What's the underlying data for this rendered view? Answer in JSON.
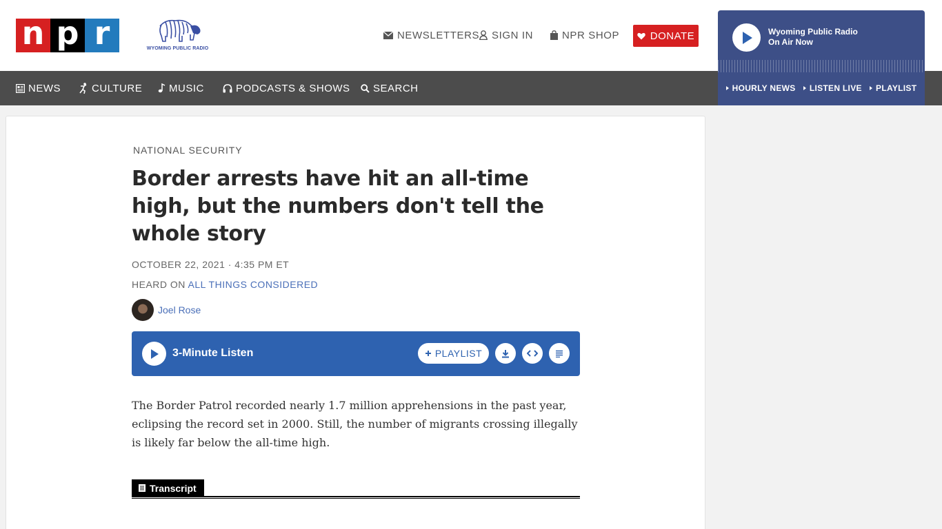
{
  "header": {
    "logo_letters": [
      "n",
      "p",
      "r"
    ],
    "station_logo_text": "WYOMING PUBLIC RADIO",
    "newsletters": "NEWSLETTERS",
    "sign_in": "SIGN IN",
    "shop": "NPR SHOP",
    "donate": "DONATE"
  },
  "nav": {
    "items": [
      {
        "label": "NEWS",
        "icon": "news-icon"
      },
      {
        "label": "CULTURE",
        "icon": "culture-icon"
      },
      {
        "label": "MUSIC",
        "icon": "music-icon"
      },
      {
        "label": "PODCASTS & SHOWS",
        "icon": "headphones-icon"
      },
      {
        "label": "SEARCH",
        "icon": "search-icon"
      }
    ]
  },
  "player": {
    "station": "Wyoming Public Radio",
    "status": "On Air Now",
    "links": [
      "HOURLY NEWS",
      "LISTEN LIVE",
      "PLAYLIST"
    ]
  },
  "article": {
    "slug": "NATIONAL SECURITY",
    "headline": "Border arrests have hit an all-time high, but the numbers don't tell the whole story",
    "date": "OCTOBER 22, 2021 · 4:35 PM ET",
    "heard_on_prefix": "HEARD ON ",
    "heard_on_show": "ALL THINGS CONSIDERED",
    "author": "Joel Rose",
    "audio_title": "3-Minute Listen",
    "playlist_label": "PLAYLIST",
    "teaser": "The Border Patrol recorded nearly 1.7 million apprehensions in the past year, eclipsing the record set in 2000. Still, the number of migrants crossing illegally is likely far below the all-time high.",
    "transcript_label": "Transcript"
  },
  "colors": {
    "npr_red": "#d62021",
    "npr_black": "#000000",
    "npr_blue": "#237bbd",
    "nav_bg": "#4c4c4c",
    "player_bg": "#3d4f87",
    "audio_bar_bg": "#2e62b0",
    "link_blue": "#4a6fb8"
  }
}
